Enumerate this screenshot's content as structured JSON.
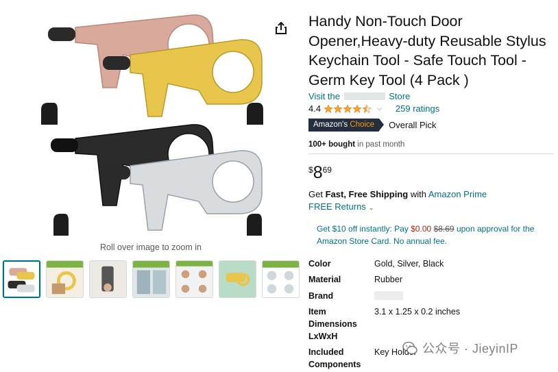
{
  "product": {
    "title": "Handy Non-Touch Door Opener,Heavy-duty Reusable Stylus Keychain Tool - Safe Touch Tool - Germ Key Tool (4 Pack )",
    "store_prefix": "Visit the",
    "store_suffix": "Store",
    "rating_value": "4.4",
    "rating_stars": 4.4,
    "ratings_count": "259 ratings",
    "badge_prefix": "Amazon's",
    "badge_choice": "Choice",
    "badge_label": "Overall Pick",
    "bought_bold": "100+ bought",
    "bought_rest": "in past month"
  },
  "price": {
    "symbol": "$",
    "whole": "8",
    "fraction": "69"
  },
  "shipping": {
    "prefix": "Get",
    "bold": "Fast, Free Shipping",
    "middle": "with",
    "prime_link": "Amazon Prime",
    "returns": "FREE Returns"
  },
  "promo": {
    "part1": "Get $10 off instantly: Pay",
    "pay_price": "$0.00",
    "old_price": "$8.69",
    "part2": "upon approval for the Amazon Store Card. No annual fee."
  },
  "gallery": {
    "zoom_hint": "Roll over image to zoom in",
    "thumb_count": 7
  },
  "specs": [
    {
      "key": "Color",
      "value": "Gold, Silver, Black"
    },
    {
      "key": "Material",
      "value": "Rubber"
    },
    {
      "key": "Brand",
      "value": ""
    },
    {
      "key": "Item Dimensions LxWxH",
      "value": "3.1 x 1.25 x 0.2 inches"
    },
    {
      "key": "Included Components",
      "value": "Key Holder"
    }
  ],
  "watermark": {
    "text": "公众号 · JieyinIP"
  },
  "colors": {
    "link": "#007185",
    "badge_bg": "#232f3e",
    "badge_accent": "#ff9900",
    "star": "#ffa41c",
    "price_red": "#b12704"
  }
}
